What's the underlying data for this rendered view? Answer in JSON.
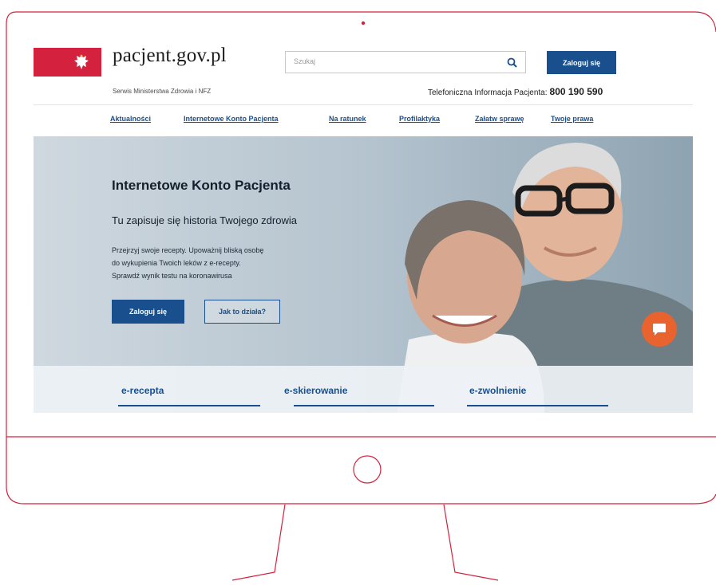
{
  "brand": {
    "name": "pacjent.gov.pl",
    "subtitle": "Serwis Ministerstwa Zdrowia i NFZ"
  },
  "search": {
    "placeholder": "Szukaj"
  },
  "header": {
    "login_label": "Zaloguj się",
    "hotline_label": "Telefoniczna Informacja Pacjenta:",
    "hotline_number": "800 190 590"
  },
  "nav": {
    "items": [
      {
        "label": "Aktualności"
      },
      {
        "label": "Internetowe Konto Pacjenta"
      },
      {
        "label": "Na ratunek"
      },
      {
        "label": "Profilaktyka"
      },
      {
        "label": "Załatw sprawę"
      },
      {
        "label": "Twoje prawa"
      }
    ]
  },
  "hero": {
    "title": "Internetowe Konto Pacjenta",
    "subtitle": "Tu zapisuje się historia Twojego zdrowia",
    "text_line1": "Przejrzyj swoje recepty. Upoważnij bliską osobę",
    "text_line2": "do wykupienia Twoich leków z e-recepty.",
    "text_line3": "Sprawdź wynik testu na koronawirusa",
    "login_label": "Zaloguj się",
    "how_label": "Jak to działa?"
  },
  "services": {
    "items": [
      {
        "label": "e-recepta"
      },
      {
        "label": "e-skierowanie"
      },
      {
        "label": "e-zwolnienie"
      }
    ]
  },
  "colors": {
    "accent_red": "#d4213d",
    "primary_blue": "#1a4f8d",
    "chat_orange": "#e8632d"
  },
  "icons": {
    "search": "search-icon",
    "eagle": "eagle-emblem-icon",
    "chat": "chat-icon",
    "power": "power-button-icon"
  }
}
